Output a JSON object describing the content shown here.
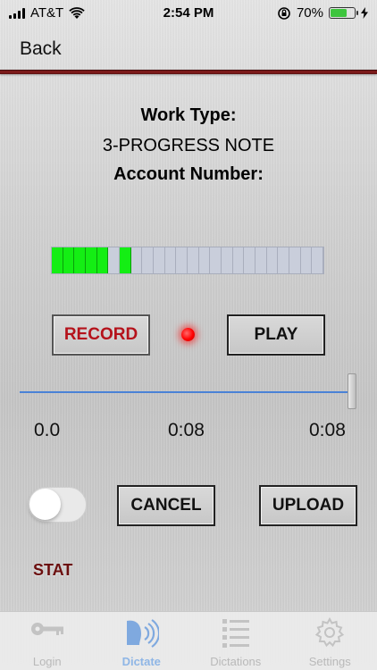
{
  "status_bar": {
    "carrier": "AT&T",
    "time": "2:54 PM",
    "battery_percent": "70%",
    "battery_level": 0.7
  },
  "nav": {
    "back_label": "Back"
  },
  "info": {
    "work_type_label": "Work Type:",
    "work_type_value": "3-PROGRESS NOTE",
    "account_number_label": "Account Number:"
  },
  "meter": {
    "segments": 24,
    "lit_segments": [
      0,
      1,
      2,
      3,
      4,
      6
    ],
    "on_color": "#14ee14",
    "off_color": "#c9cedb"
  },
  "controls": {
    "record_label": "RECORD",
    "play_label": "PLAY",
    "cancel_label": "CANCEL",
    "upload_label": "UPLOAD",
    "stat_label": "STAT",
    "stat_on": false
  },
  "playback": {
    "position": 1.0,
    "start_time": "0.0",
    "current_time": "0:08",
    "end_time": "0:08"
  },
  "tabs": [
    {
      "label": "Login",
      "icon": "key-icon",
      "active": false
    },
    {
      "label": "Dictate",
      "icon": "voice-icon",
      "active": true
    },
    {
      "label": "Dictations",
      "icon": "list-icon",
      "active": false
    },
    {
      "label": "Settings",
      "icon": "gear-icon",
      "active": false
    }
  ],
  "colors": {
    "accent_red": "#b5121b",
    "divider_red": "#8b1d1d",
    "slider_blue": "#4a82d6",
    "tab_active": "#8fb6e6"
  }
}
